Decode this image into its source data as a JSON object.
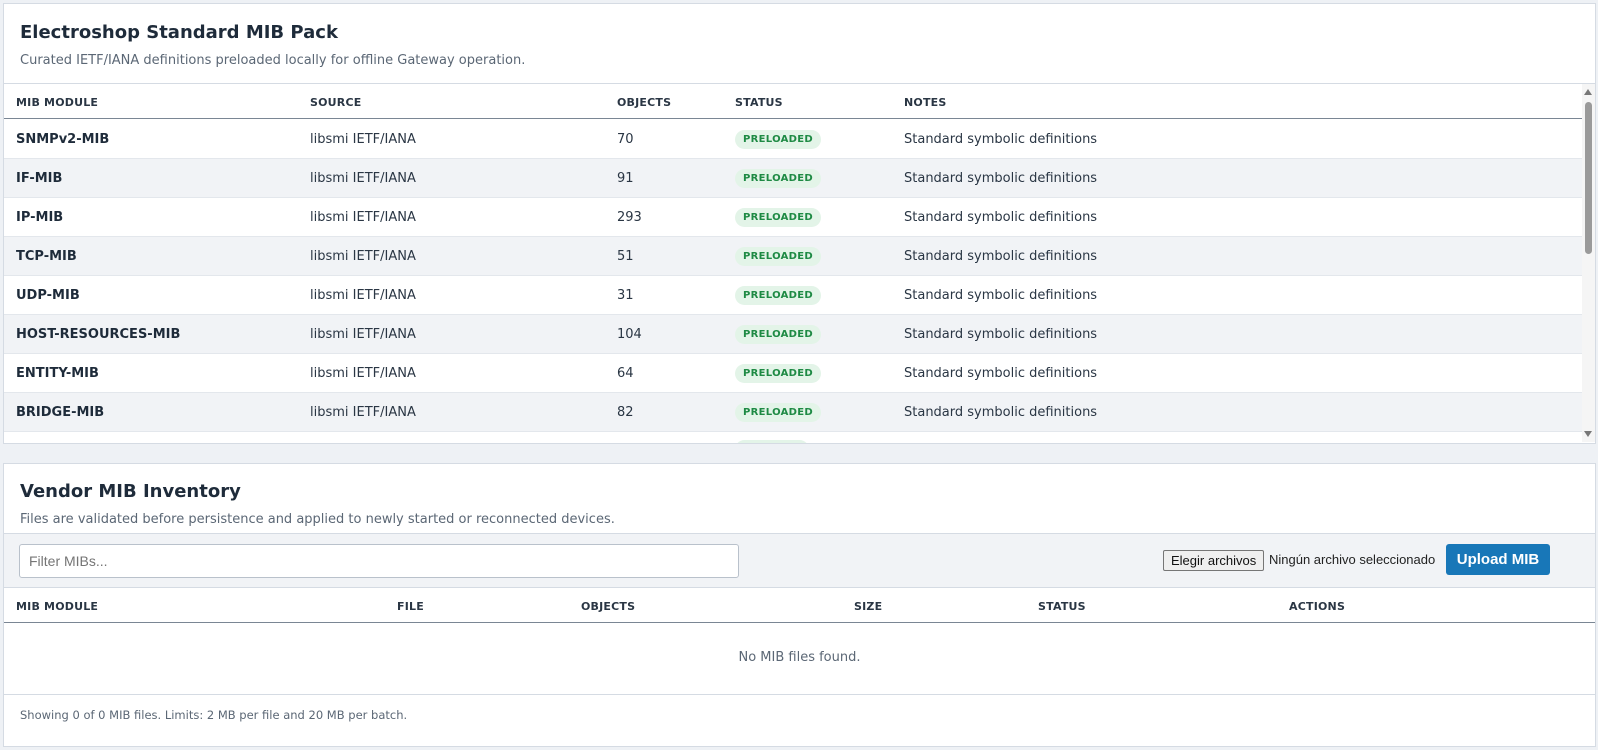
{
  "standard": {
    "title": "Electroshop Standard MIB Pack",
    "subtitle": "Curated IETF/IANA definitions preloaded locally for offline Gateway operation.",
    "columns": {
      "module": "MIB MODULE",
      "source": "SOURCE",
      "objects": "OBJECTS",
      "status": "STATUS",
      "notes": "NOTES"
    },
    "rows": [
      {
        "module": "SNMPv2-MIB",
        "source": "libsmi IETF/IANA",
        "objects": "70",
        "status": "PRELOADED",
        "notes": "Standard symbolic definitions"
      },
      {
        "module": "IF-MIB",
        "source": "libsmi IETF/IANA",
        "objects": "91",
        "status": "PRELOADED",
        "notes": "Standard symbolic definitions"
      },
      {
        "module": "IP-MIB",
        "source": "libsmi IETF/IANA",
        "objects": "293",
        "status": "PRELOADED",
        "notes": "Standard symbolic definitions"
      },
      {
        "module": "TCP-MIB",
        "source": "libsmi IETF/IANA",
        "objects": "51",
        "status": "PRELOADED",
        "notes": "Standard symbolic definitions"
      },
      {
        "module": "UDP-MIB",
        "source": "libsmi IETF/IANA",
        "objects": "31",
        "status": "PRELOADED",
        "notes": "Standard symbolic definitions"
      },
      {
        "module": "HOST-RESOURCES-MIB",
        "source": "libsmi IETF/IANA",
        "objects": "104",
        "status": "PRELOADED",
        "notes": "Standard symbolic definitions"
      },
      {
        "module": "ENTITY-MIB",
        "source": "libsmi IETF/IANA",
        "objects": "64",
        "status": "PRELOADED",
        "notes": "Standard symbolic definitions"
      },
      {
        "module": "BRIDGE-MIB",
        "source": "libsmi IETF/IANA",
        "objects": "82",
        "status": "PRELOADED",
        "notes": "Standard symbolic definitions"
      }
    ]
  },
  "vendor": {
    "title": "Vendor MIB Inventory",
    "subtitle": "Files are validated before persistence and applied to newly started or reconnected devices.",
    "filter_placeholder": "Filter MIBs...",
    "choose_files_label": "Elegir archivos",
    "no_file_label": "Ningún archivo seleccionado",
    "upload_label": "Upload MIB",
    "columns": {
      "module": "MIB MODULE",
      "file": "FILE",
      "objects": "OBJECTS",
      "size": "SIZE",
      "status": "STATUS",
      "actions": "ACTIONS"
    },
    "empty_message": "No MIB files found.",
    "footer": "Showing 0 of 0 MIB files. Limits: 2 MB per file and 20 MB per batch."
  },
  "colors": {
    "accent": "#1877b8",
    "badge_bg": "#e3f4e8",
    "badge_text": "#1e8a44"
  }
}
